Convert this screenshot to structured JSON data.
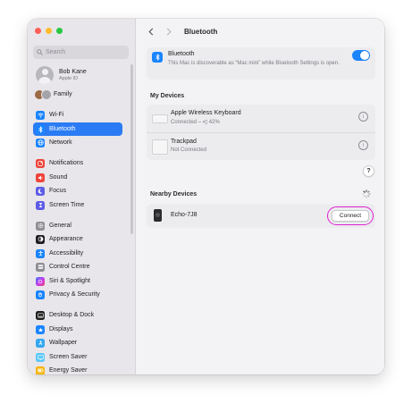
{
  "window": {
    "title": "Bluetooth"
  },
  "sidebar": {
    "search_placeholder": "Search",
    "profile": {
      "name": "Bob Kane",
      "subtitle": "Apple ID"
    },
    "items": [
      {
        "label": "Family",
        "icon": "family-icon",
        "color": ""
      },
      {
        "label": "Wi-Fi",
        "icon": "wifi-icon",
        "color": "#1a84ff"
      },
      {
        "label": "Bluetooth",
        "icon": "bluetooth-icon",
        "color": "#1a84ff",
        "active": true
      },
      {
        "label": "Network",
        "icon": "globe-icon",
        "color": "#1a84ff"
      },
      {
        "label": "Notifications",
        "icon": "bell-icon",
        "color": "#f0443a"
      },
      {
        "label": "Sound",
        "icon": "speaker-icon",
        "color": "#f0443a"
      },
      {
        "label": "Focus",
        "icon": "moon-icon",
        "color": "#5e5ce6"
      },
      {
        "label": "Screen Time",
        "icon": "hourglass-icon",
        "color": "#5e5ce6"
      },
      {
        "label": "General",
        "icon": "gear-icon",
        "color": "#8e8e93"
      },
      {
        "label": "Appearance",
        "icon": "appearance-icon",
        "color": "#1d1d1f"
      },
      {
        "label": "Accessibility",
        "icon": "accessibility-icon",
        "color": "#1a84ff"
      },
      {
        "label": "Control Centre",
        "icon": "control-centre-icon",
        "color": "#8e8e93"
      },
      {
        "label": "Siri & Spotlight",
        "icon": "siri-icon",
        "color": "#c13cf0"
      },
      {
        "label": "Privacy & Security",
        "icon": "hand-icon",
        "color": "#1a84ff"
      },
      {
        "label": "Desktop & Dock",
        "icon": "dock-icon",
        "color": "#1d1d1f"
      },
      {
        "label": "Displays",
        "icon": "display-icon",
        "color": "#1a84ff"
      },
      {
        "label": "Wallpaper",
        "icon": "wallpaper-icon",
        "color": "#35a8f0"
      },
      {
        "label": "Screen Saver",
        "icon": "screen-saver-icon",
        "color": "#5ac8fa"
      },
      {
        "label": "Energy Saver",
        "icon": "battery-icon",
        "color": "#f7b500"
      }
    ]
  },
  "bluetooth": {
    "title": "Bluetooth",
    "description": "This Mac is discoverable as “Mac mini” while Bluetooth Settings is open.",
    "enabled": true
  },
  "my_devices": {
    "heading": "My Devices",
    "devices": [
      {
        "name": "Apple Wireless Keyboard",
        "status": "Connected – ▪▯ 42%",
        "battery_percent": 42
      },
      {
        "name": "Trackpad",
        "status": "Not Connected"
      }
    ]
  },
  "help_label": "?",
  "nearby": {
    "heading": "Nearby Devices",
    "devices": [
      {
        "name": "Echo-7J8",
        "action": "Connect"
      }
    ]
  },
  "colors": {
    "accent": "#1a84ff",
    "highlight_ring": "#e11fd3"
  }
}
